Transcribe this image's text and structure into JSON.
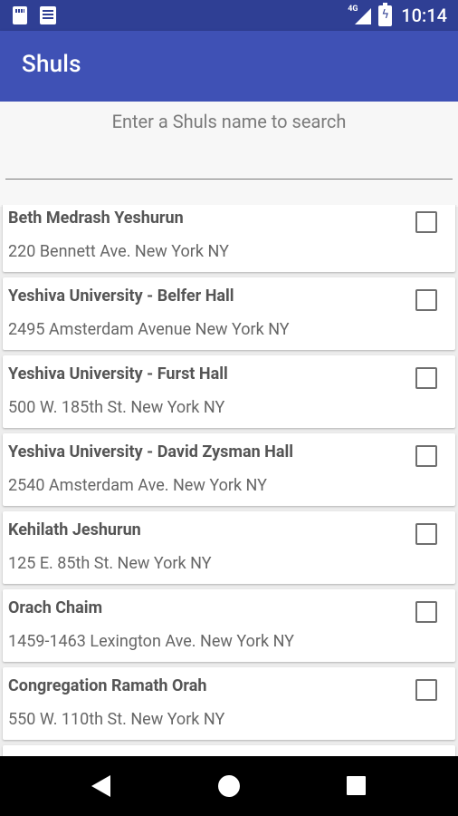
{
  "status_bar": {
    "time": "10:14",
    "network": "4G",
    "icons": [
      "sd-card-icon",
      "news-icon",
      "signal-icon",
      "battery-icon"
    ]
  },
  "app_bar": {
    "title": "Shuls"
  },
  "search": {
    "placeholder": "Enter a Shuls name to search",
    "value": ""
  },
  "shuls": [
    {
      "name": "Beth Medrash Yeshurun",
      "address": "220 Bennett Ave. New York NY"
    },
    {
      "name": "Yeshiva University - Belfer Hall",
      "address": "2495 Amsterdam Avenue New York NY"
    },
    {
      "name": "Yeshiva University - Furst Hall",
      "address": "500 W. 185th St. New York NY"
    },
    {
      "name": "Yeshiva University - David Zysman Hall",
      "address": "2540 Amsterdam Ave. New York NY"
    },
    {
      "name": "Kehilath Jeshurun",
      "address": "125 E. 85th St. New York NY"
    },
    {
      "name": "Orach Chaim",
      "address": "1459-1463 Lexington Ave. New York NY"
    },
    {
      "name": "Congregation Ramath Orah",
      "address": "550 W. 110th St. New York NY"
    },
    {
      "name": "",
      "address": ""
    }
  ],
  "colors": {
    "status_bar": "#2f3f94",
    "app_bar": "#3f51b5",
    "nav_bar": "#000000"
  }
}
